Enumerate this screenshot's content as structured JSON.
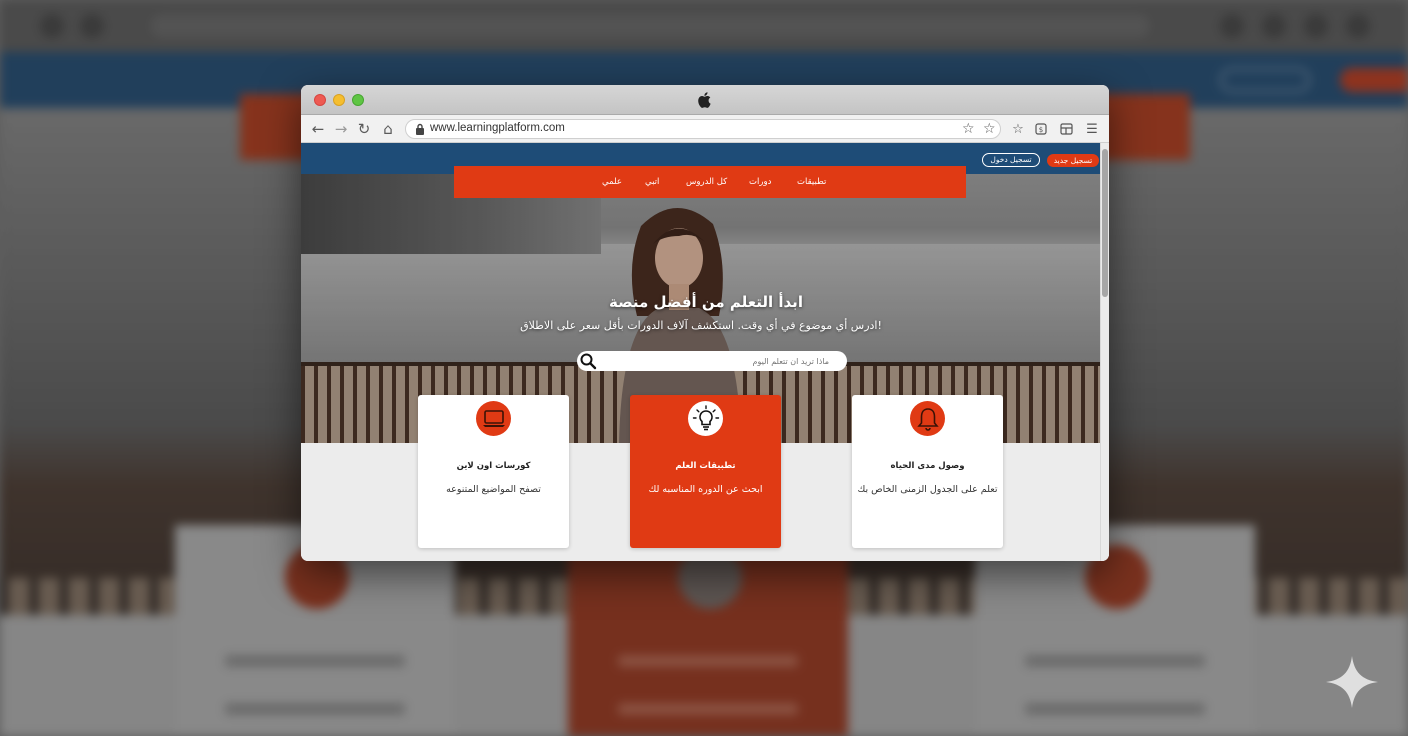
{
  "browser": {
    "url": "www.learningplatform.com"
  },
  "site": {
    "header": {
      "signup_label": "تسجيل جديد",
      "login_label": "تسجيل دخول"
    },
    "nav": [
      {
        "label": "تطبيقات"
      },
      {
        "label": "دورات"
      },
      {
        "label": "كل الدروس"
      },
      {
        "label": "اتبي"
      },
      {
        "label": "علمي"
      }
    ],
    "hero": {
      "title": "ابدأ التعلم من أفضل منصة",
      "subtitle": "ادرس أي موضوع في أي وقت. استكشف آلاف الدورات بأقل سعر على الاطلاق!",
      "search_placeholder": "ماذا تريد ان تتعلم اليوم"
    },
    "cards": [
      {
        "title": "كورسات اون لاين",
        "description": "تصفح المواضيع المتنوعه",
        "icon": "laptop-icon"
      },
      {
        "title": "تطبيقات العلم",
        "description": "ابحث عن الدوره المناسبه لك",
        "icon": "lightbulb-icon"
      },
      {
        "title": "وصول مدى الحياه",
        "description": "تعلم على الجدول الزمنى الخاص بك",
        "icon": "bell-icon"
      }
    ]
  },
  "colors": {
    "accent": "#e03a14",
    "header_blue": "#1e4c77",
    "page_bg": "#ececec"
  }
}
